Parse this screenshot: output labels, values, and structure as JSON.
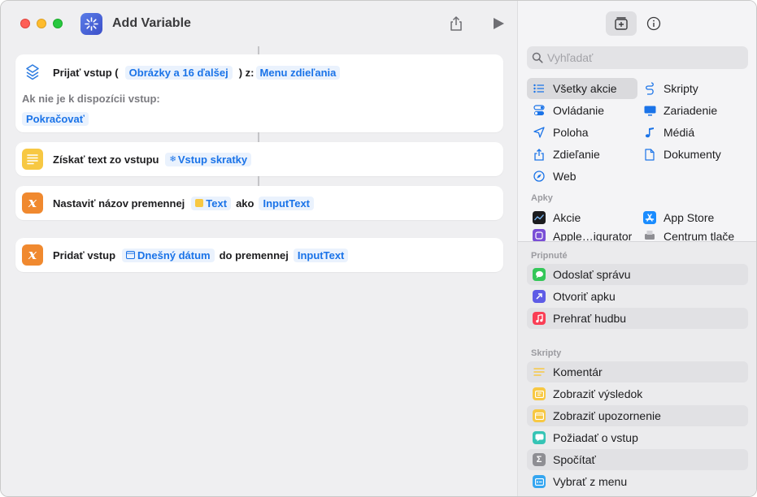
{
  "window": {
    "title": "Add Variable"
  },
  "editor": {
    "actions": [
      {
        "label": "Prijať vstup (",
        "input_token": "Obrázky a 16 ďalšej",
        "from_label": ") z:",
        "from_token": "Menu zdieľania",
        "fallback_label": "Ak nie je k dispozícii vstup:",
        "fallback_token": "Pokračovať"
      },
      {
        "label": "Získať text zo vstupu",
        "token": "Vstup skratky"
      },
      {
        "label": "Nastaviť názov premennej",
        "token": "Text",
        "mid_label": "ako",
        "token2": "InputText"
      },
      {
        "label": "Pridať vstup",
        "token": "Dnešný dátum",
        "mid_label": "do premennej",
        "token2": "InputText"
      }
    ]
  },
  "library": {
    "search_placeholder": "Vyhľadať",
    "categories_left": [
      "Všetky akcie",
      "Ovládanie",
      "Poloha",
      "Zdieľanie",
      "Web"
    ],
    "categories_right": [
      "Skripty",
      "Zariadenie",
      "Médiá",
      "Dokumenty"
    ],
    "apps_header": "Apky",
    "apps": [
      "Akcie",
      "App Store",
      "Apple…igurator",
      "Centrum tlače"
    ],
    "pinned_header": "Pripnuté",
    "pinned": [
      "Odoslať správu",
      "Otvoriť apku",
      "Prehrať hudbu"
    ],
    "scripts_header": "Skripty",
    "scripts": [
      "Komentár",
      "Zobraziť výsledok",
      "Zobraziť upozornenie",
      "Požiadať o vstup",
      "Spočítať",
      "Vybrať z menu"
    ]
  },
  "colors": {
    "accent": "#1a73e8",
    "card_bg": "#ffffff",
    "editor_bg": "#efeff1",
    "set_var_orange": "#f0892f",
    "text_yellow": "#f7c843"
  }
}
